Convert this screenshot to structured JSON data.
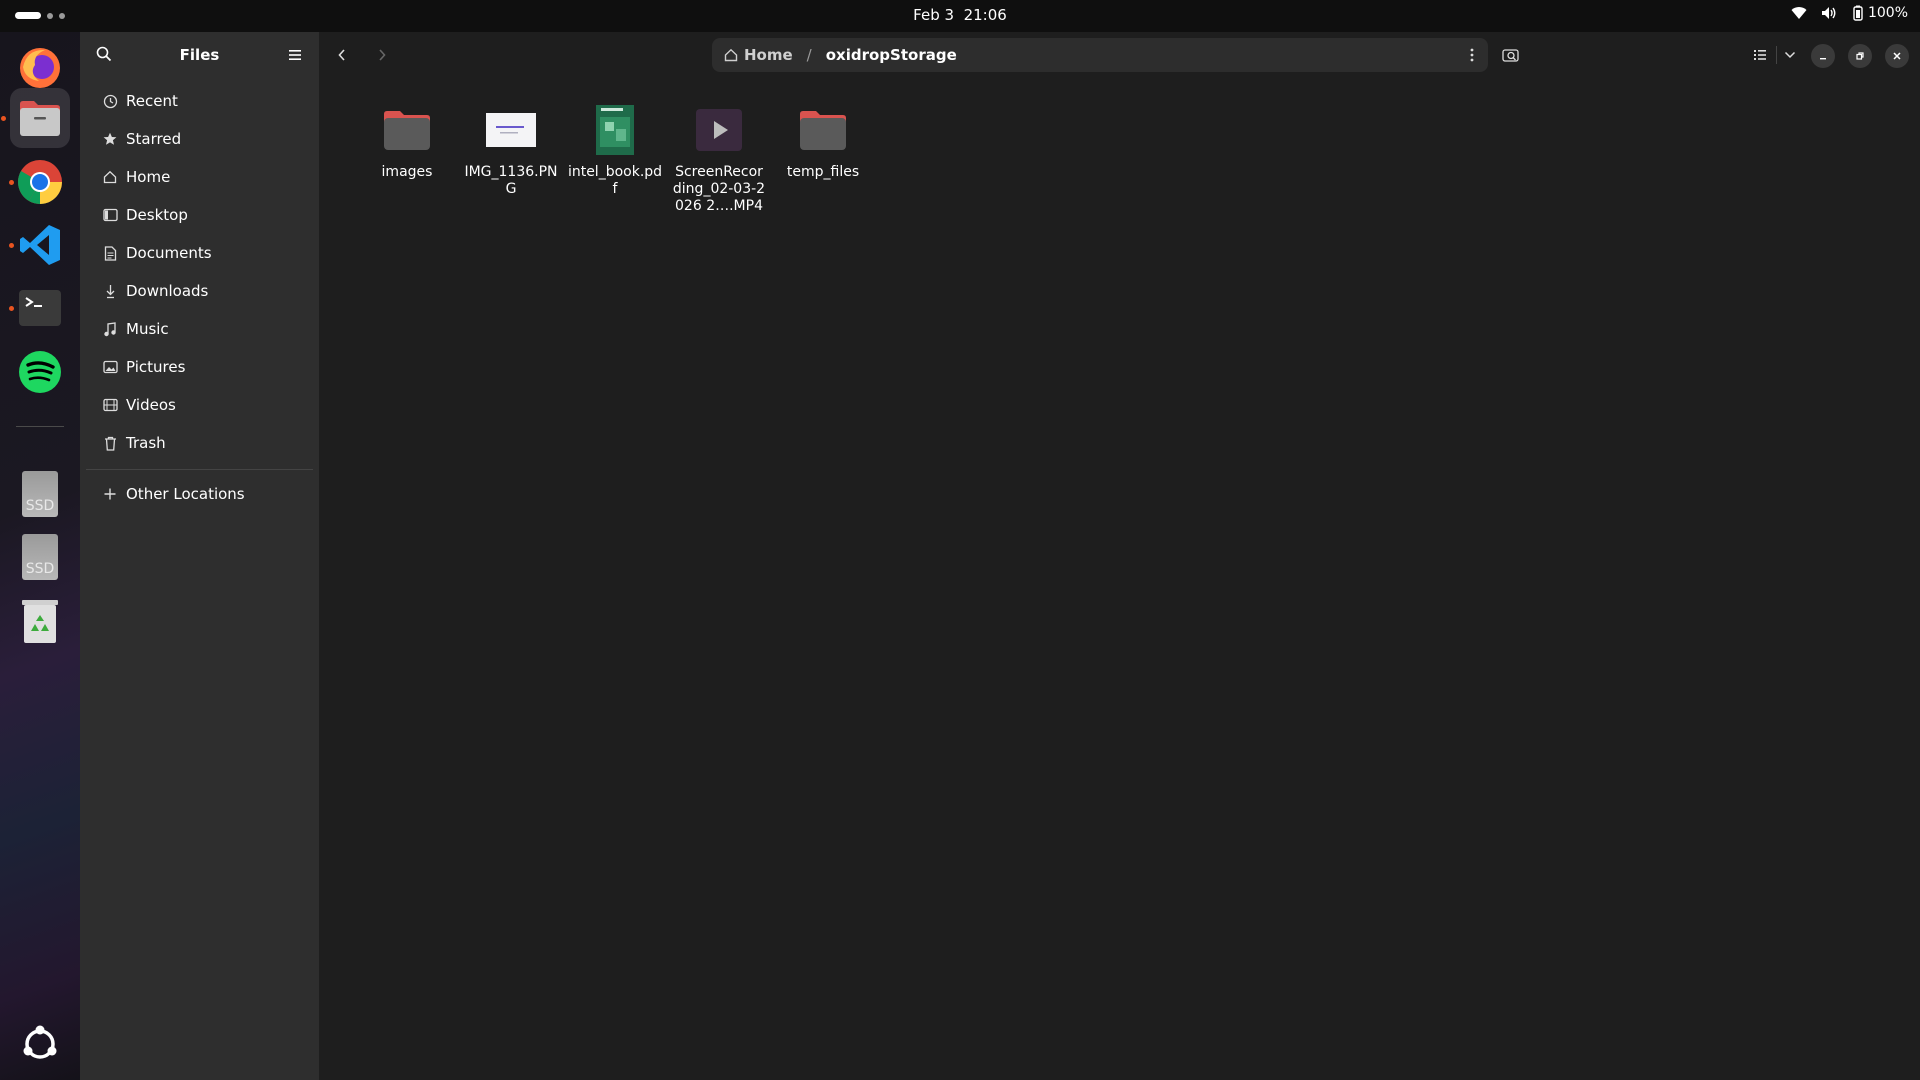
{
  "topbar": {
    "date": "Feb 3",
    "time": "21:06",
    "battery": "100%"
  },
  "dock": {
    "apps": [
      "firefox-icon",
      "files-icon",
      "chrome-icon",
      "vscode-icon",
      "terminal-icon",
      "spotify-icon",
      "ssd-drive-icon",
      "ssd-drive-icon",
      "trash-icon"
    ],
    "ssd_label": "SSD"
  },
  "sidebar": {
    "title": "Files",
    "items": [
      {
        "label": "Recent",
        "icon": "clock-icon"
      },
      {
        "label": "Starred",
        "icon": "star-icon"
      },
      {
        "label": "Home",
        "icon": "home-icon"
      },
      {
        "label": "Desktop",
        "icon": "desktop-icon"
      },
      {
        "label": "Documents",
        "icon": "document-icon"
      },
      {
        "label": "Downloads",
        "icon": "download-icon"
      },
      {
        "label": "Music",
        "icon": "music-icon"
      },
      {
        "label": "Pictures",
        "icon": "picture-icon"
      },
      {
        "label": "Videos",
        "icon": "video-icon"
      },
      {
        "label": "Trash",
        "icon": "trash-icon"
      }
    ],
    "other_locations": "Other Locations"
  },
  "path": {
    "home": "Home",
    "separator": "/",
    "current": "oxidropStorage"
  },
  "files": [
    {
      "name": "images",
      "type": "folder"
    },
    {
      "name": "IMG_1136.PNG",
      "type": "image"
    },
    {
      "name": "intel_book.pdf",
      "type": "pdf"
    },
    {
      "name": "ScreenRecording_02-03-2026 2….MP4",
      "type": "video"
    },
    {
      "name": "temp_files",
      "type": "folder"
    }
  ],
  "colors": {
    "folder_top": "#d9534f",
    "folder_body": "#5a5a5a",
    "accent": "#e95420"
  }
}
